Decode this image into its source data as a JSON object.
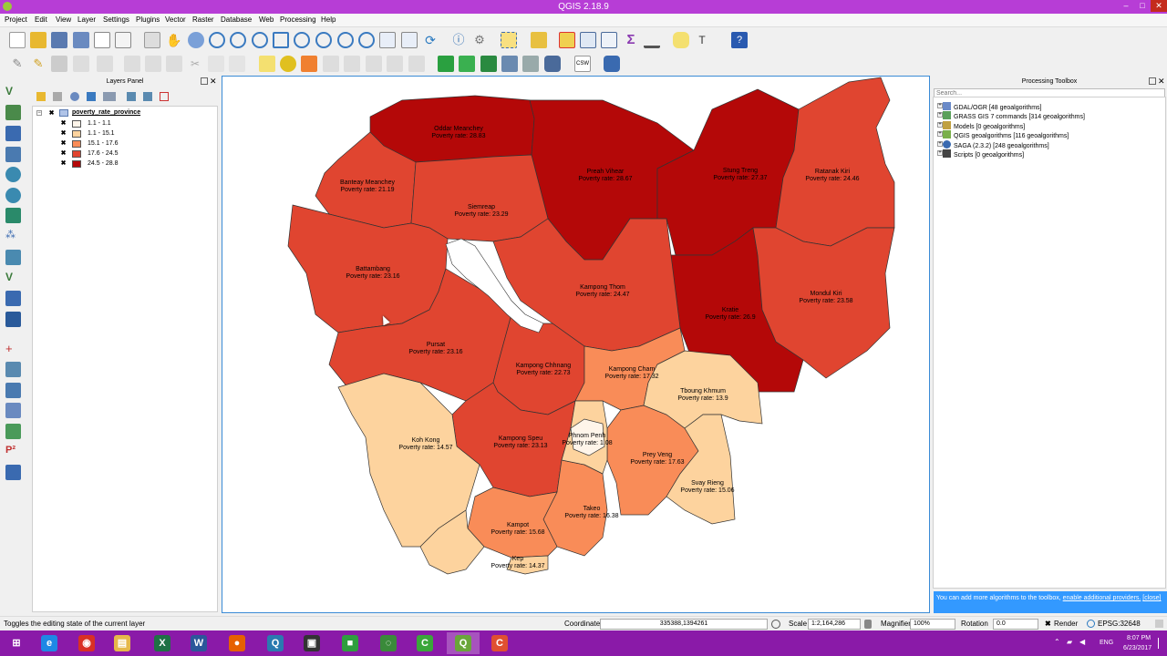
{
  "window": {
    "title": "QGIS 2.18.9",
    "min": "–",
    "max": "□",
    "close": "✕"
  },
  "menu": [
    "Project",
    "Edit",
    "View",
    "Layer",
    "Settings",
    "Plugins",
    "Vector",
    "Raster",
    "Database",
    "Web",
    "Processing",
    "Help"
  ],
  "layers_panel": {
    "title": "Layers Panel",
    "layer_name": "poverty_rate_province",
    "legend": [
      {
        "label": "1.1 - 1.1",
        "color": "#fff5ea"
      },
      {
        "label": "1.1 - 15.1",
        "color": "#fdd39e"
      },
      {
        "label": "15.1 - 17.6",
        "color": "#f98c58"
      },
      {
        "label": "17.6 - 24.5",
        "color": "#e04530"
      },
      {
        "label": "24.5 - 28.8",
        "color": "#b40808"
      }
    ]
  },
  "map": {
    "provinces": [
      {
        "name": "Oddar Meanchey",
        "rate": "Poverty rate: 28.83"
      },
      {
        "name": "Preah Vihear",
        "rate": "Poverty rate: 28.67"
      },
      {
        "name": "Stung Treng",
        "rate": "Poverty rate: 27.37"
      },
      {
        "name": "Ratanak Kiri",
        "rate": "Poverty rate: 24.46"
      },
      {
        "name": "Banteay Meanchey",
        "rate": "Poverty rate: 21.19"
      },
      {
        "name": "Siemreap",
        "rate": "Poverty rate: 23.29"
      },
      {
        "name": "Battambang",
        "rate": "Poverty rate: 23.16"
      },
      {
        "name": "Kampong Thom",
        "rate": "Poverty rate: 24.47"
      },
      {
        "name": "Kratie",
        "rate": "Poverty rate: 26.9"
      },
      {
        "name": "Mondul Kiri",
        "rate": "Poverty rate: 23.58"
      },
      {
        "name": "Pursat",
        "rate": "Poverty rate: 23.16"
      },
      {
        "name": "Kampong Chhnang",
        "rate": "Poverty rate: 22.73"
      },
      {
        "name": "Kampong Cham",
        "rate": "Poverty rate: 17.32"
      },
      {
        "name": "Tboung Khmum",
        "rate": "Poverty rate: 13.9"
      },
      {
        "name": "Koh Kong",
        "rate": "Poverty rate: 14.57"
      },
      {
        "name": "Kampong Speu",
        "rate": "Poverty rate: 23.13"
      },
      {
        "name": "Phnom Penh",
        "rate": "Poverty rate: 1.08"
      },
      {
        "name": "Prey Veng",
        "rate": "Poverty rate: 17.63"
      },
      {
        "name": "Svay Rieng",
        "rate": "Poverty rate: 15.06"
      },
      {
        "name": "Takeo",
        "rate": "Poverty rate: 16.38"
      },
      {
        "name": "Kampot",
        "rate": "Poverty rate: 15.68"
      },
      {
        "name": "Kep",
        "rate": "Poverty rate: 14.37"
      }
    ]
  },
  "toolbox": {
    "title": "Processing Toolbox",
    "search_placeholder": "Search...",
    "items": [
      {
        "label": "GDAL/OGR [48 geoalgorithms]",
        "color": "#6a8ac8"
      },
      {
        "label": "GRASS GIS 7 commands [314 geoalgorithms]",
        "color": "#5aa05a"
      },
      {
        "label": "Models [0 geoalgorithms]",
        "color": "#c0a040"
      },
      {
        "label": "QGIS geoalgorithms [116 geoalgorithms]",
        "color": "#7ab04a"
      },
      {
        "label": "SAGA (2.3.2) [248 geoalgorithms]",
        "color": "#3a6ab0"
      },
      {
        "label": "Scripts [0 geoalgorithms]",
        "color": "#444444"
      }
    ],
    "note_text": "You can add more algorithms to the toolbox,",
    "note_link": "enable additional providers.",
    "note_close": "[close]"
  },
  "status": {
    "message": "Toggles the editing state of the current layer",
    "coordinate_label": "Coordinate",
    "coordinate_value": "335388,1394261",
    "scale_label": "Scale",
    "scale_value": "1:2,164,286",
    "magnifier_label": "Magnifier",
    "magnifier_value": "100%",
    "rotation_label": "Rotation",
    "rotation_value": "0.0",
    "render_label": "Render",
    "crs": "EPSG:32648"
  },
  "taskbar": {
    "lang": "ENG",
    "time": "8:07 PM",
    "date": "6/23/2017",
    "apps": [
      {
        "name": "start",
        "glyph": "⊞",
        "color": "#8a1aa8"
      },
      {
        "name": "ie",
        "glyph": "e",
        "color": "#1e88e5"
      },
      {
        "name": "chrome",
        "glyph": "◉",
        "color": "#d93025"
      },
      {
        "name": "explorer",
        "glyph": "▤",
        "color": "#e6b84a"
      },
      {
        "name": "excel",
        "glyph": "X",
        "color": "#1e7145"
      },
      {
        "name": "word",
        "glyph": "W",
        "color": "#2b579a"
      },
      {
        "name": "firefox",
        "glyph": "●",
        "color": "#e66000"
      },
      {
        "name": "search",
        "glyph": "Q",
        "color": "#2a7ab0"
      },
      {
        "name": "lock",
        "glyph": "▣",
        "color": "#333333"
      },
      {
        "name": "green-app",
        "glyph": "■",
        "color": "#2e9e3e"
      },
      {
        "name": "globe",
        "glyph": "◌",
        "color": "#3a8a3a"
      },
      {
        "name": "camtasia",
        "glyph": "C",
        "color": "#3aa63a"
      },
      {
        "name": "qgis",
        "glyph": "Q",
        "color": "#6aa63a"
      },
      {
        "name": "recorder",
        "glyph": "C",
        "color": "#e05030"
      }
    ]
  },
  "colors": {
    "titlebar": "#b73dd6",
    "taskbar": "#8a1aa8",
    "map_border": "#3a8bd6"
  }
}
